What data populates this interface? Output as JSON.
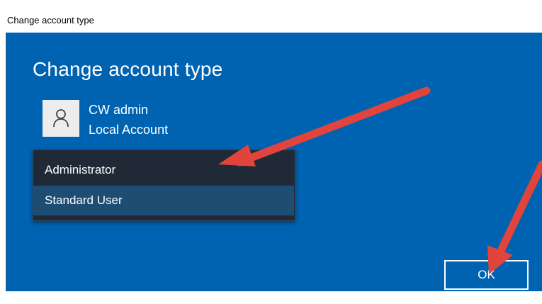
{
  "window": {
    "title": "Change account type"
  },
  "page": {
    "heading": "Change account type"
  },
  "account": {
    "name": "CW admin",
    "type": "Local Account",
    "avatar_icon": "user-icon"
  },
  "dropdown": {
    "options": [
      {
        "label": "Administrator",
        "selected": false
      },
      {
        "label": "Standard User",
        "selected": true
      }
    ]
  },
  "buttons": {
    "ok_label": "OK"
  },
  "annotations": {
    "arrow_color": "#e0443c",
    "arrow_icons": [
      "arrow-to-administrator-icon",
      "arrow-to-ok-icon"
    ]
  },
  "colors": {
    "accent": "#0063b1",
    "dropdown_bg": "#1f2a36",
    "dropdown_selected_bg": "#1e4d74"
  }
}
